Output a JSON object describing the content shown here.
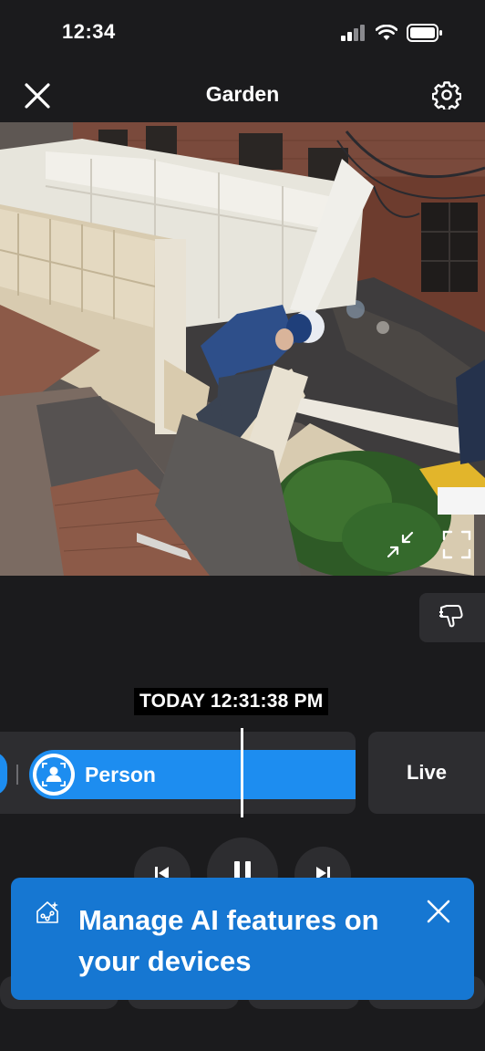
{
  "status_bar": {
    "time": "12:34"
  },
  "header": {
    "title": "Garden"
  },
  "player": {
    "timestamp": "TODAY 12:31:38 PM",
    "event_label": "Person",
    "live_label": "Live"
  },
  "banner": {
    "text": "Manage AI features on your devices"
  },
  "icons": {
    "close": "close-icon",
    "settings": "gear-icon",
    "exit_fullscreen": "collapse-arrows-icon",
    "fullscreen": "expand-corners-icon",
    "feedback": "thumbs-down-icon",
    "person": "person-icon",
    "previous": "skip-back-icon",
    "pause": "pause-icon",
    "next": "skip-forward-icon",
    "ai": "ai-home-icon"
  },
  "colors": {
    "background": "#1b1b1d",
    "surface": "#2d2d30",
    "accent": "#1d8df0",
    "banner": "#1677d2"
  }
}
